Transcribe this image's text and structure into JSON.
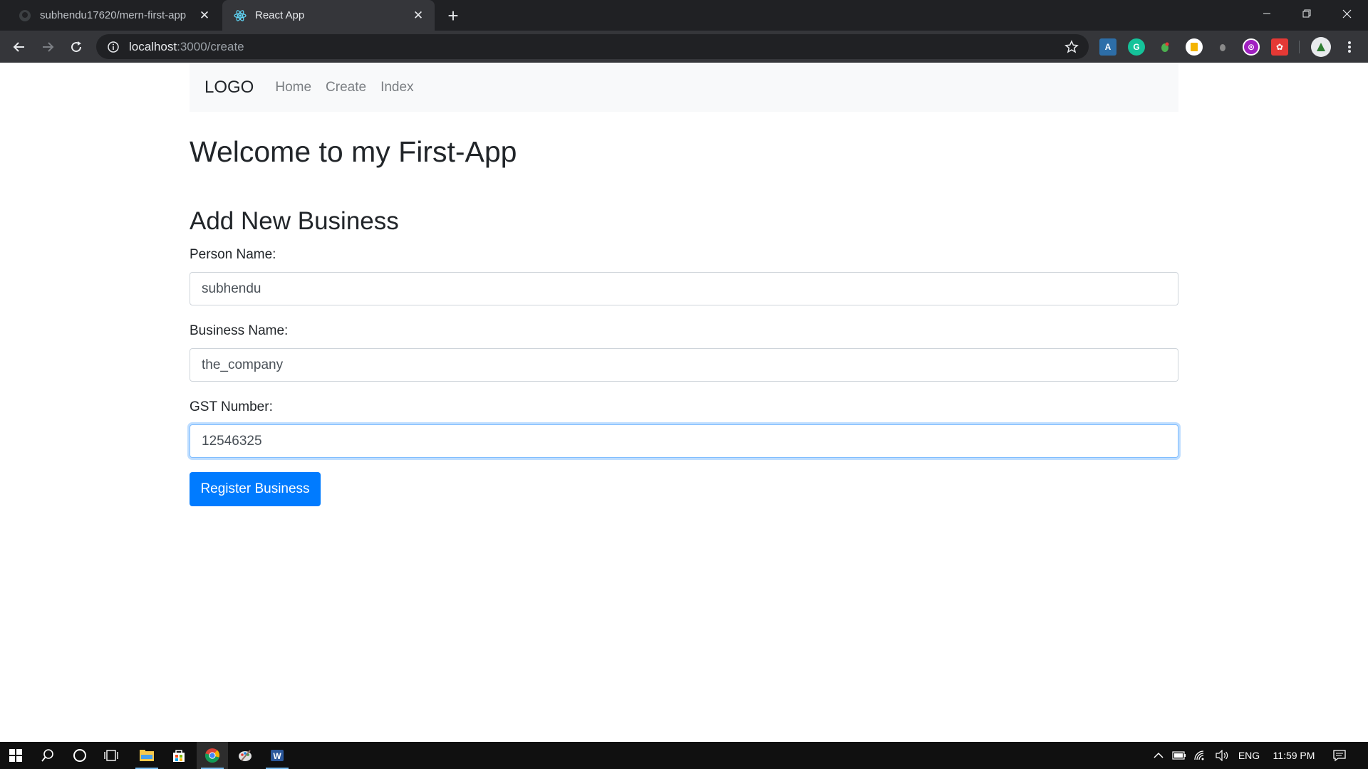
{
  "browser": {
    "tabs": [
      {
        "title": "subhendu17620/mern-first-app",
        "favicon": "github-icon",
        "active": false
      },
      {
        "title": "React App",
        "favicon": "react-icon",
        "active": true
      }
    ],
    "url": {
      "host": "localhost",
      "path": ":3000/create"
    },
    "extensions": [
      "ext-a-icon",
      "grammarly-icon",
      "ext-leaf-icon",
      "ext-note-icon",
      "ext-grey-icon",
      "ext-purple-icon",
      "ext-red-icon",
      "profile-avatar-icon"
    ]
  },
  "navbar": {
    "brand": "LOGO",
    "links": [
      "Home",
      "Create",
      "Index"
    ]
  },
  "page": {
    "heading": "Welcome to my First-App",
    "form_title": "Add New Business"
  },
  "form": {
    "person_label": "Person Name:",
    "person_value": "subhendu",
    "business_label": "Business Name:",
    "business_value": "the_company",
    "gst_label": "GST Number:",
    "gst_value": "12546325",
    "submit_label": "Register Business"
  },
  "taskbar": {
    "apps": [
      "windows-start-icon",
      "search-icon",
      "cortana-icon",
      "task-view-icon",
      "file-explorer-icon",
      "store-icon",
      "chrome-icon",
      "paint-icon",
      "word-icon"
    ],
    "language": "ENG",
    "time": "11:59 PM"
  },
  "colors": {
    "primary": "#007bff",
    "focus_ring": "#80bdff",
    "navbar_bg": "#f8f9fa",
    "chrome_dark": "#202124"
  }
}
